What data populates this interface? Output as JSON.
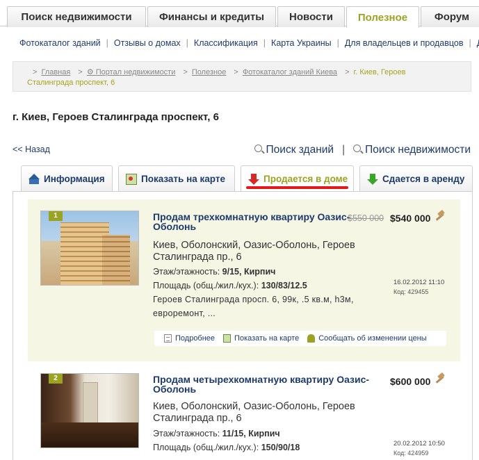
{
  "top_nav": {
    "tabs": [
      {
        "label": "Поиск недвижимости"
      },
      {
        "label": "Финансы и кредиты"
      },
      {
        "label": "Новости"
      },
      {
        "label": "Полезное",
        "active": true
      },
      {
        "label": "Форум"
      }
    ]
  },
  "sub_nav": {
    "items": [
      "Фотокаталог зданий",
      "Отзывы о домах",
      "Классификация",
      "Карта Украины",
      "Для владельцев и продавцов",
      "Д"
    ]
  },
  "breadcrumb": {
    "items": [
      "Главная",
      "Портал недвижимости",
      "Полезное",
      "Фотокаталог зданий Киева"
    ],
    "current_line1": "г. Киев, Героев",
    "current_line2": "Сталинграда проспект, 6"
  },
  "page_title": "г. Киев, Героев Сталинграда проспект, 6",
  "back_link": "<< Назад",
  "search_links": {
    "buildings": "Поиск зданий",
    "separator": "|",
    "realty": "Поиск недвижимости"
  },
  "content_tabs": [
    {
      "label": "Информация",
      "icon": "home-icon"
    },
    {
      "label": "Показать на карте",
      "icon": "map-icon"
    },
    {
      "label": "Продается в доме",
      "icon": "red-down-arrow-icon",
      "active": true
    },
    {
      "label": "Сдается в аренду",
      "icon": "green-down-arrow-icon"
    }
  ],
  "colors": {
    "accent": "#9aa322",
    "link": "#1d3a6d",
    "highlight_bg": "#f5f6e4",
    "underline_red": "#e41a1a"
  },
  "listings": [
    {
      "num": "1",
      "title": "Продам трехкомнатную квартиру Оазис-Оболонь",
      "old_price": "$550 000",
      "price": "$540 000",
      "address": "Киев, Оболонский, Оазис-Оболонь, Героев Сталинграда пр., 6",
      "floor_label": "Этаж/этажность:",
      "floor_value": "9/15, Кирпич",
      "area_label": "Площадь (общ./жил./кух.):",
      "area_value": "130/83/12.5",
      "description": "Героев Сталинграда просп. 6, 99к, .5 кв.м, h3м, евроремонт, ...",
      "date": "16.02.2012 11:10",
      "code": "Код: 429455",
      "actions": [
        "Подробнее",
        "Показать на карте",
        "Сообщать об изменении цены"
      ]
    },
    {
      "num": "2",
      "title": "Продам четырехкомнатную квартиру Оазис-Оболонь",
      "old_price": "",
      "price": "$600 000",
      "address": "Киев, Оболонский, Оазис-Оболонь, Героев Сталинграда пр., 6",
      "floor_label": "Этаж/этажность:",
      "floor_value": "11/15, Кирпич",
      "area_label": "Площадь (общ./жил./кух.):",
      "area_value": "150/90/18",
      "date": "20.02.2012 10:50",
      "code": "Код: 424959"
    }
  ]
}
